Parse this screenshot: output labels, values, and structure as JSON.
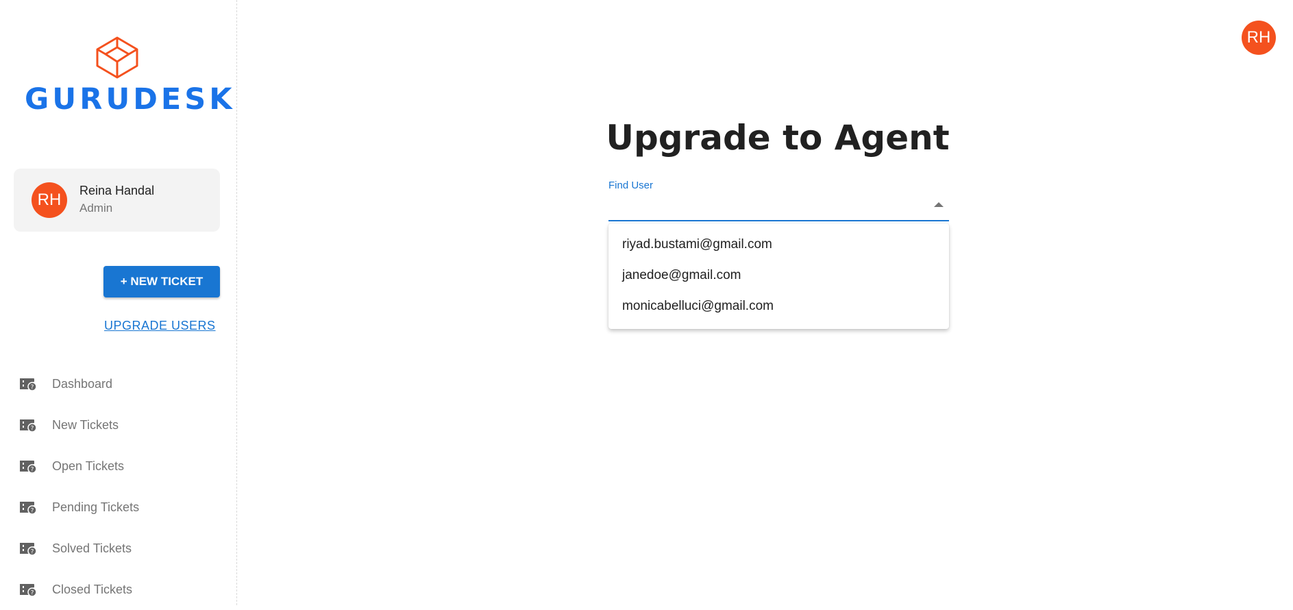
{
  "brand": {
    "name": "GURUDESK",
    "logo_icon": "cube-logo-icon",
    "logo_color": "#f4511e",
    "text_color": "#1a73e8"
  },
  "user": {
    "initials": "RH",
    "name": "Reina Handal",
    "role": "Admin",
    "avatar_color": "#f4511e"
  },
  "actions": {
    "new_ticket": "+ NEW TICKET",
    "upgrade_users": "UPGRADE USERS"
  },
  "nav": {
    "items": [
      {
        "label": "Dashboard",
        "icon": "ticket-icon"
      },
      {
        "label": "New Tickets",
        "icon": "ticket-icon"
      },
      {
        "label": "Open Tickets",
        "icon": "ticket-icon"
      },
      {
        "label": "Pending Tickets",
        "icon": "ticket-icon"
      },
      {
        "label": "Solved Tickets",
        "icon": "ticket-icon"
      },
      {
        "label": "Closed Tickets",
        "icon": "ticket-icon"
      }
    ]
  },
  "topbar": {
    "avatar_initials": "RH"
  },
  "main": {
    "title": "Upgrade to Agent",
    "find_user": {
      "label": "Find User",
      "value": ""
    },
    "options": [
      "riyad.bustami@gmail.com",
      "janedoe@gmail.com",
      "monicabelluci@gmail.com"
    ]
  },
  "colors": {
    "primary": "#1976d2",
    "accent": "#f4511e"
  }
}
